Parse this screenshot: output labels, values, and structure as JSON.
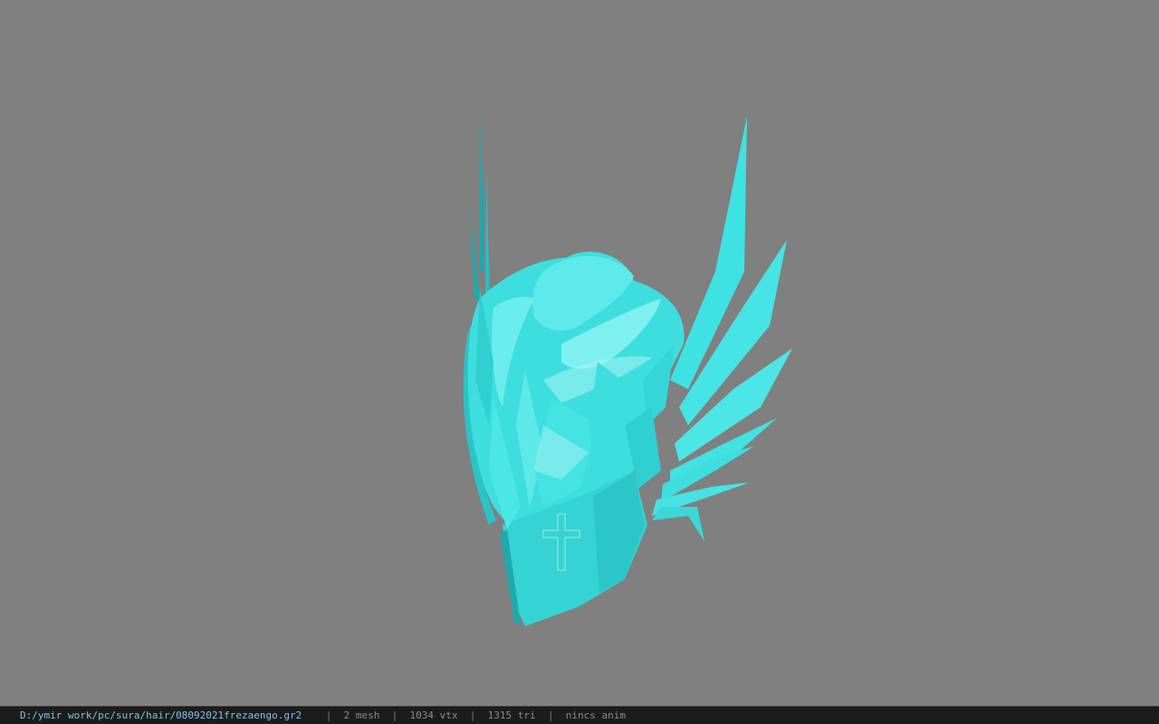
{
  "viewer": {
    "background_color": "#808080",
    "model": {
      "color": "#3fdede",
      "highlight_color": "#a8f4f4",
      "shadow_color": "#1fa9ad",
      "icon": "helmet-mesh"
    }
  },
  "statusbar": {
    "file_path": "D:/ymir work/pc/sura/hair/08092021frezaengo.gr2",
    "separator": "|",
    "mesh_count": "2 mesh",
    "vertex_count": "1034 vtx",
    "triangle_count": "1315 tri",
    "anim_status": "nincs anim"
  }
}
